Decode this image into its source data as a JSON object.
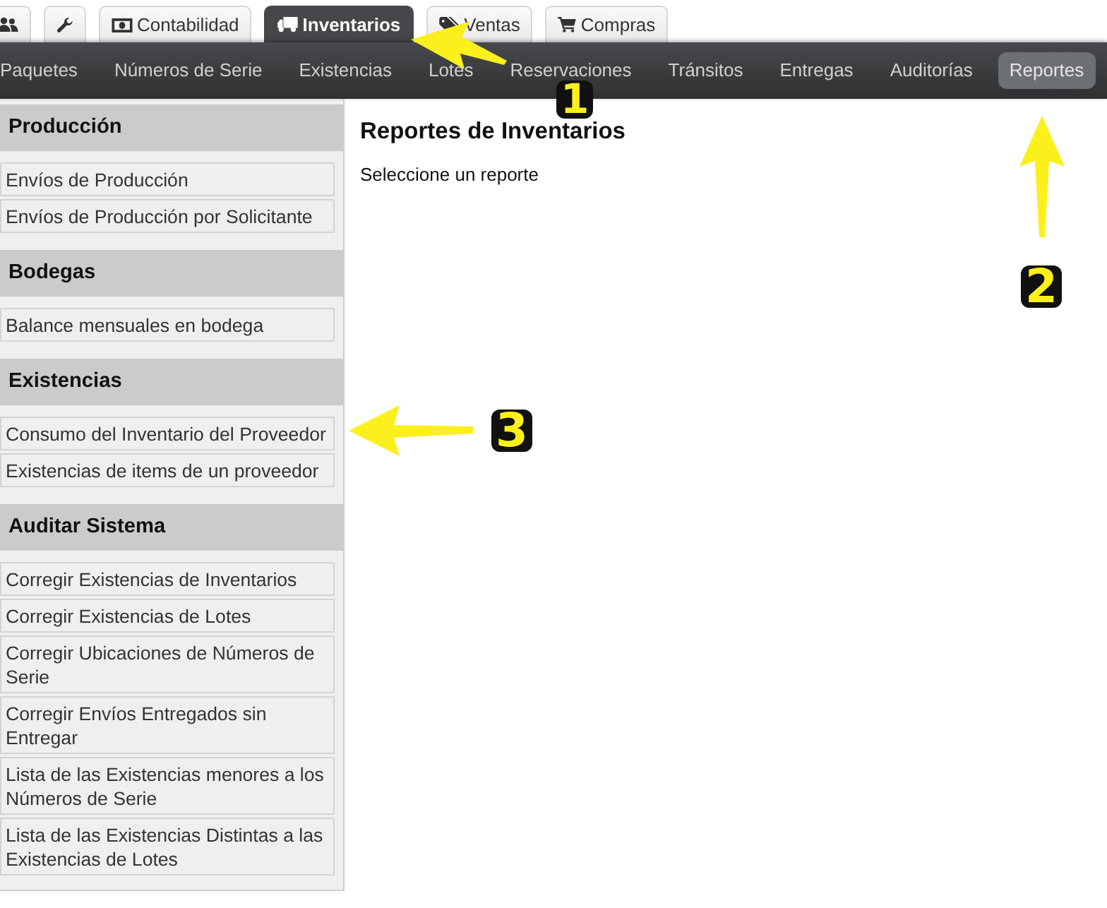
{
  "tabs": [
    {
      "selected": false
    },
    {
      "selected": false
    },
    {
      "label": "Contabilidad",
      "selected": false
    },
    {
      "label": "Inventarios",
      "selected": true
    },
    {
      "label": "Ventas",
      "selected": false
    },
    {
      "label": "Compras",
      "selected": false
    }
  ],
  "nav": [
    {
      "label": "Paquetes",
      "selected": false
    },
    {
      "label": "Números de Serie",
      "selected": false
    },
    {
      "label": "Existencias",
      "selected": false
    },
    {
      "label": "Lotes",
      "selected": false
    },
    {
      "label": "Reservaciones",
      "selected": false
    },
    {
      "label": "Tránsitos",
      "selected": false
    },
    {
      "label": "Entregas",
      "selected": false
    },
    {
      "label": "Auditorías",
      "selected": false
    },
    {
      "label": "Reportes",
      "selected": true
    }
  ],
  "sidebar": {
    "sections": [
      {
        "title": "Producción",
        "items": [
          "Envíos de Producción",
          "Envíos de Producción por Solicitante"
        ]
      },
      {
        "title": "Bodegas",
        "items": [
          "Balance mensuales en bodega"
        ]
      },
      {
        "title": "Existencias",
        "items": [
          "Consumo del Inventario del Proveedor",
          "Existencias de items de un proveedor"
        ]
      },
      {
        "title": "Auditar Sistema",
        "items": [
          "Corregir Existencias de Inventarios",
          "Corregir Existencias de Lotes",
          "Corregir Ubicaciones de Números de Serie",
          "Corregir Envíos Entregados sin Entregar",
          "Lista de las Existencias menores a los Números de Serie",
          "Lista de las Existencias Distintas a las Existencias de Lotes"
        ]
      }
    ]
  },
  "content": {
    "title": "Reportes de Inventarios",
    "text": "Seleccione un reporte"
  },
  "annotations": [
    {
      "label": "1"
    },
    {
      "label": "2"
    },
    {
      "label": "3"
    }
  ]
}
